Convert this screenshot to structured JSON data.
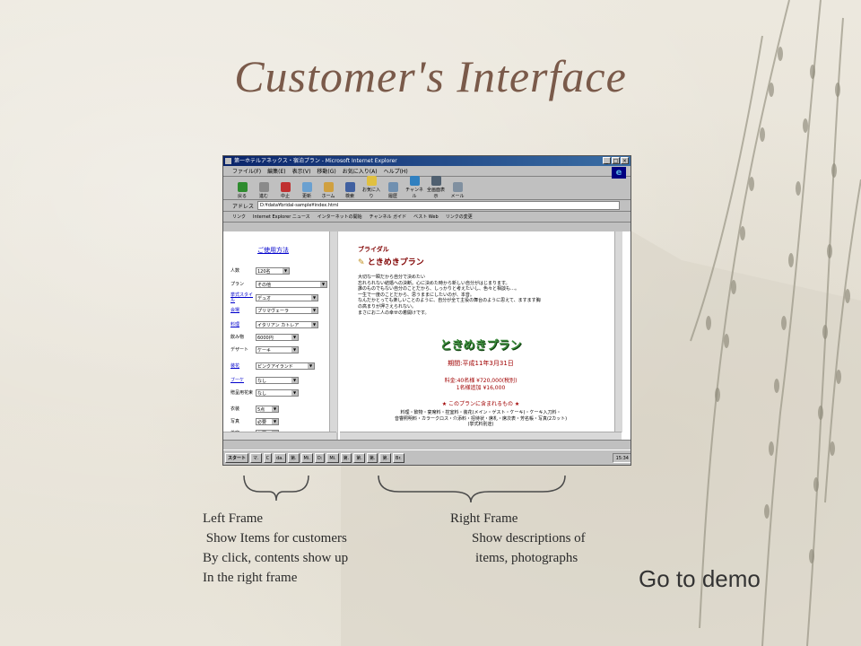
{
  "slide": {
    "title": "Customer's Interface",
    "left_note": [
      "Left Frame",
      " Show Items for customers",
      "By click, contents show up",
      "In the right frame"
    ],
    "right_note": [
      "Right Frame",
      "Show descriptions of",
      "items, photographs"
    ],
    "demo_link": "Go to demo"
  },
  "browser": {
    "window_title": "第一ホテルアネックス・宿泊プラン - Microsoft Internet Explorer",
    "menu": [
      "ファイル(F)",
      "編集(E)",
      "表示(V)",
      "移動(G)",
      "お気に入り(A)",
      "ヘルプ(H)"
    ],
    "toolbar": [
      "戻る",
      "進む",
      "中止",
      "更新",
      "ホーム",
      "検索",
      "お気に入り",
      "履歴",
      "チャンネル",
      "全画面表示",
      "メール"
    ],
    "address_label": "アドレス",
    "address_value": "D:¥data¥bridal-sample¥index.html",
    "links_label": "リンク",
    "links": [
      "Internet Explorer ニュース",
      "インターネットの開始",
      "チャンネル ガイド",
      "ベスト Web",
      "リンクの変更"
    ]
  },
  "left_frame": {
    "heading": "ご使用方法",
    "rows": [
      {
        "label": "人数",
        "value": "120名"
      },
      {
        "label": "プラン",
        "value": "その他"
      },
      {
        "label": "挙式スタイル",
        "value": "デュオ"
      },
      {
        "label": "会場",
        "value": "プリマヴェーラ"
      },
      {
        "label": "料理",
        "value": "イタリアン カトレア"
      },
      {
        "label": "飲み物",
        "value": "6000円"
      },
      {
        "label": "デザート",
        "value": "ケーキ"
      },
      {
        "label": "装花",
        "value": "ピンクアイランド"
      },
      {
        "label": "ブーケ",
        "value": "なし"
      },
      {
        "label": "贈呈用花束",
        "value": "なし"
      },
      {
        "label": "衣装",
        "value": "5点"
      },
      {
        "label": "写真",
        "value": "必要"
      },
      {
        "label": "美容",
        "value": "必要"
      }
    ]
  },
  "right_frame": {
    "tag": "ブライダル",
    "plan_name": "ときめきプラン",
    "description": [
      "大切な一瞬だから自分で決めたい",
      "忘れられない結婚への決断。心に決めた時から新しい自分がはじまります。",
      "誰のものでもない自分のことだから、しっかりと考えたいし、色々と相談も…。",
      "一生で一度のことだから、思うままにしたいのが、本音。",
      "なんだかとっても楽しいことのように、自分が全て主役の舞台のように思えて、ますます胸",
      "の高まりが押さえられない。",
      "まさにお二人の幸せの着開けです。"
    ],
    "big_title": "ときめきプラン",
    "period": "期間:平成11年3月31日",
    "price": "料金:40名様 ¥720,000(税別)",
    "price_extra": "1名様追加 ¥16,000",
    "included_heading": "★ このプランに含まれるもの ★",
    "included": [
      "料理・飲物・宴席料・控室料・装花(メイン・ゲスト・ケーキ)・ケーキ入刀料・",
      "音響照明料・カラークロス・介添料・招待状・席札・席次表・芳名帳・写真(2カット)",
      "(挙式料別途)"
    ]
  },
  "taskbar": {
    "start": "スタート",
    "tasks": [
      "マ.",
      "C",
      "da.",
      "第.",
      "Mi.",
      "D:",
      "Mi.",
      "第.",
      "第.",
      "第.",
      "第.",
      "Br."
    ],
    "clock": "15:34"
  }
}
